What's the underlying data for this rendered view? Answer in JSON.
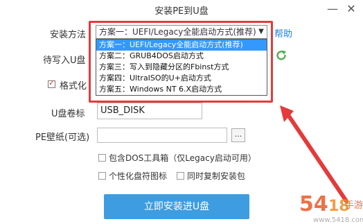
{
  "window": {
    "title": "安装PE到U盘",
    "minimize_icon": "minimize-icon",
    "close_icon": "close-icon"
  },
  "labels": {
    "install_method": "安装方法",
    "target_disk": "待写入U盘",
    "format": "格式化",
    "volume_label": "U盘卷标",
    "pe_wallpaper": "PE壁纸(可选)"
  },
  "install_method": {
    "selected": "方案一：UEFI/Legacy全能启动方式(推荐)",
    "options": [
      "方案一：UEFI/Legacy全能启动方式(推荐)",
      "方案二：GRUB4DOS启动方式",
      "方案三：写入到隐藏分区的Fbinst方式",
      "方案四：UltraISO的U+启动方式",
      "方案五：Windows NT 6.X启动方式"
    ],
    "help": "帮助"
  },
  "volume_label_value": "USB_DISK",
  "pe_wallpaper_value": "",
  "browse_label": "...",
  "options": {
    "include_dos_tools": "包含DOS工具箱（仅Legacy启动可用）",
    "personalize_icon": "个性化盘符图标",
    "copy_installer": "同时复制安装包"
  },
  "format_checked": true,
  "install_button": "立即安装进U盘",
  "colors": {
    "highlight": "#3399ff",
    "outline": "#e53a3a",
    "install_button": "#3d9de0",
    "help_link": "#1a82e2"
  }
}
